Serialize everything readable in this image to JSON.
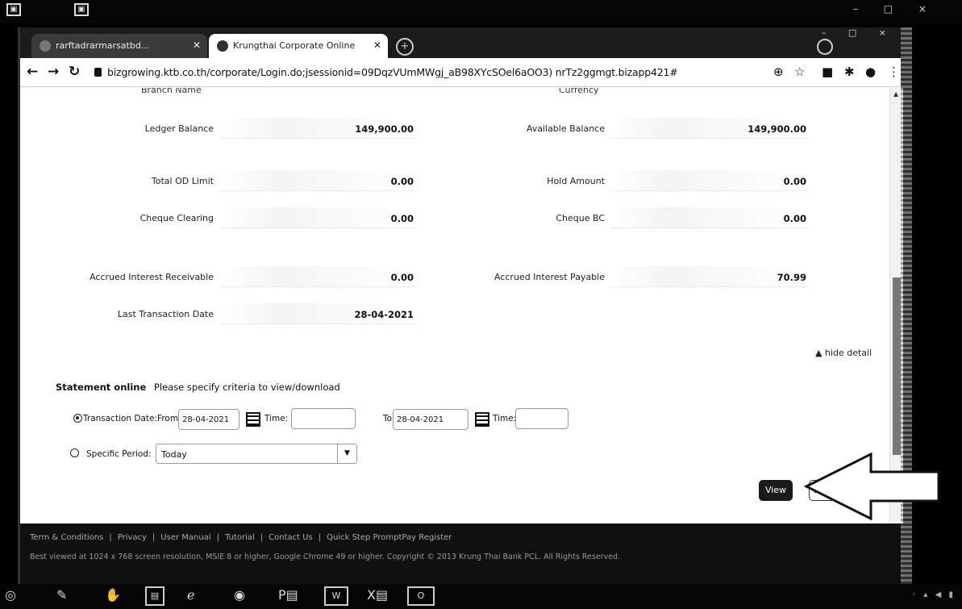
{
  "browser": {
    "tabs": [
      {
        "label": "rarftadrarmarsatbd..."
      },
      {
        "label": "Krungthai Corporate Online"
      }
    ],
    "url": "bizgrowing.ktb.co.th/corporate/Login.do;jsessionid=09DqzVUmMWgj_aB98XYcSOel6aOO3) nrTz2ggmgt.bizapp421#"
  },
  "account": {
    "cut_left_label": "Branch Name",
    "cut_right_label": "Currency",
    "ledger_balance_label": "Ledger Balance",
    "ledger_balance": "149,900.00",
    "available_balance_label": "Available Balance",
    "available_balance": "149,900.00",
    "total_od_limit_label": "Total OD Limit",
    "total_od_limit": "0.00",
    "hold_amount_label": "Hold Amount",
    "hold_amount": "0.00",
    "cheque_clearing_label": "Cheque Clearing",
    "cheque_clearing": "0.00",
    "cheque_bc_label": "Cheque BC",
    "cheque_bc": "0.00",
    "accrued_recv_label": "Accrued Interest Receivable",
    "accrued_recv": "0.00",
    "accrued_pay_label": "Accrued Interest Payable",
    "accrued_pay": "70.99",
    "last_txn_label": "Last Transaction Date",
    "last_txn": "28-04-2021",
    "hide_detail": "hide detail"
  },
  "statement": {
    "title": "Statement online",
    "hint": "Please specify criteria to view/download",
    "txn_date_label": "Transaction Date:From",
    "from_date": "28-04-2021",
    "time_label": "Time:",
    "to_label": "To",
    "to_date": "28-04-2021",
    "to_time_label": "Time:",
    "specific_period_label": "Specific Period:",
    "period_value": "Today",
    "view_button": "View",
    "download_button": "Download"
  },
  "footer": {
    "links": [
      "Term & Conditions",
      "Privacy",
      "User Manual",
      "Tutorial",
      "Contact Us",
      "Quick Step PromptPay Register"
    ],
    "copyright": "Best viewed at 1024 x 768 screen resolution, MSIE 8 or higher, Google Chrome 49 or higher. Copyright © 2013 Krung Thai Bank PCL. All Rights Reserved."
  }
}
